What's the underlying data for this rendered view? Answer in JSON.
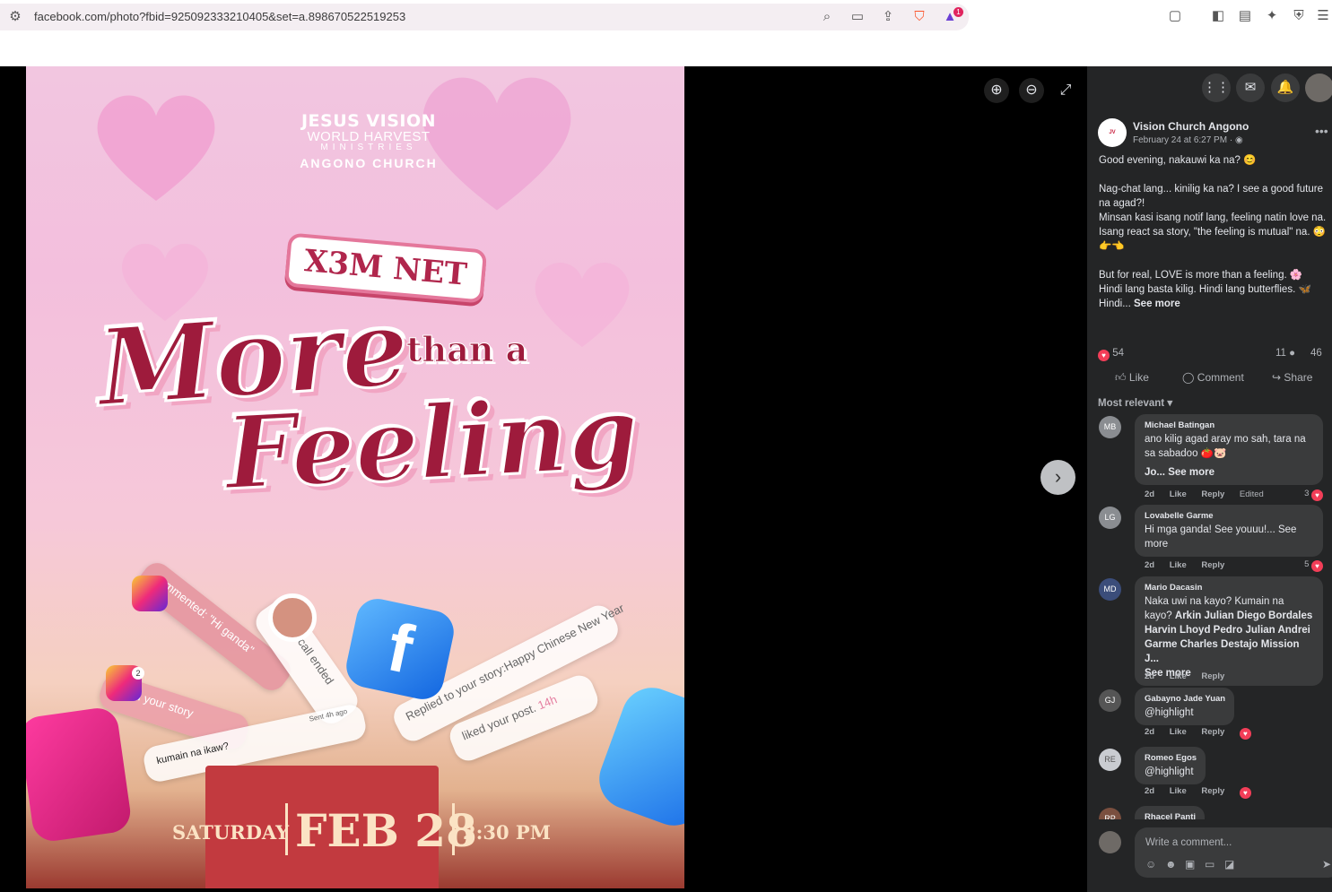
{
  "browser": {
    "url": "facebook.com/photo?fbid=925092333210405&set=a.898670522519253",
    "badge_count": "1"
  },
  "poster": {
    "church_line1": "JESUS VISION",
    "church_line2": "WORLD HARVEST",
    "church_line3": "MINISTRIES",
    "church_line4": "ANGONO CHURCH",
    "badge": "X3M NET",
    "title_more": "More",
    "title_than": "than a",
    "title_feeling": "Feeling",
    "notif_comment": "commented: \"Hi ganda\"",
    "notif_audio": "Audio call ended",
    "notif_story": "Replied to your story:Happy Chinese New Year",
    "notif_post": "liked your post.",
    "notif_post_time": "14h",
    "notif_liked": "Liked your story",
    "notif_chat": "kumain na ikaw?",
    "notif_chat_time": "Sent 4h ago",
    "ig_badge": "2",
    "day": "SATURDAY",
    "date": "FEB 28",
    "time": "2:30 PM"
  },
  "post": {
    "page_name": "Vision Church Angono",
    "date": "February 24 at 6:27 PM · ",
    "p1": "Good evening, nakauwi ka na? 😊",
    "p2a": "Nag-chat lang... kinilig ka na? I see a good future na agad?!",
    "p2b": "Minsan kasi isang notif lang, feeling natin love na.",
    "p2c": "Isang react sa story, \"the feeling is mutual\" na. 😳👉👈",
    "p3a": "But for real, LOVE is more than a feeling. 🌸",
    "p3b": "Hindi lang basta kilig. Hindi lang butterflies. 🦋",
    "p3c": "Hindi...",
    "see_more": "See more",
    "reactions": "54",
    "comments_count": "11",
    "shares_count": "46",
    "like": "Like",
    "comment": "Comment",
    "share": "Share",
    "sort": "Most relevant"
  },
  "comments": [
    {
      "name": "Michael Batingan",
      "text": "ano kilig agad aray mo sah, tara na sa sabadoo 🍅🐷",
      "more": "Jo... See more",
      "time": "2d",
      "like": "Like",
      "reply": "Reply",
      "edited": "Edited",
      "count": "3"
    },
    {
      "name": "Lovabelle Garme",
      "text": "Hi mga ganda! See youuu!... See more",
      "time": "2d",
      "like": "Like",
      "reply": "Reply",
      "count": "5"
    },
    {
      "name": "Mario Dacasin",
      "text": "Naka uwi na kayo? Kumain na kayo? ",
      "bold_text": "Arkin Julian Diego Bordales Harvin Lhoyd Pedro Julian Andrei Garme Charles Destajo Mission J...",
      "more": "See more",
      "time": "2d",
      "like": "Like",
      "reply": "Reply"
    },
    {
      "name": "Gabayno Jade Yuan",
      "text": "@highlight",
      "time": "2d",
      "like": "Like",
      "reply": "Reply"
    },
    {
      "name": "Romeo Egos",
      "text": "@highlight",
      "time": "2d",
      "like": "Like",
      "reply": "Reply"
    },
    {
      "name": "Rhacel Panti"
    }
  ],
  "composer": {
    "placeholder": "Write a comment..."
  },
  "colors": {
    "fb_dark": "#242526",
    "bubble": "#3a3b3c",
    "love": "#f33e58",
    "poster_red": "#9e1b3c"
  }
}
